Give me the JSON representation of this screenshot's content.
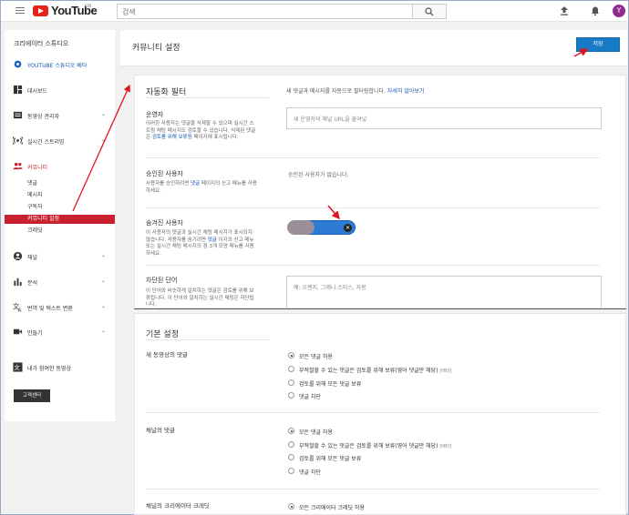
{
  "header": {
    "logo_text": "YouTube",
    "logo_region": "GB",
    "search_placeholder": "검색"
  },
  "sidebar": {
    "title": "크리에이터 스튜디오",
    "studio_beta": "YOUTUBE 스튜디오 베타",
    "dashboard": "대시보드",
    "video_manager": "동영상 관리자",
    "live": "실시간 스트리밍",
    "community": "커뮤니티",
    "community_items": [
      "댓글",
      "메시지",
      "구독자",
      "커뮤니티 설정",
      "크레딧"
    ],
    "channel": "채널",
    "analytics": "분석",
    "translation": "번역 및 텍스트 변환",
    "create": "만들기",
    "contributed": "내가 참여한 동영상",
    "help_button": "고객센터"
  },
  "main": {
    "title": "커뮤니티 설정",
    "save_label": "저장"
  },
  "auto_filter": {
    "title": "자동화 필터",
    "description": "새 댓글과 메시지를 자동으로 필터링합니다.",
    "learn_more": "자세히 알아보기",
    "moderators": {
      "title": "운영자",
      "desc_1": "이러한 사용자는 댓글을 삭제할 수 있으며 실시간 스트림 채팅 메시지도 검토할 수 있습니다. 삭제된 댓글은",
      "desc_link": "검토를 위해 보류됨",
      "desc_2": "페이지에 표시됩니다.",
      "placeholder": "새 운영자의 채널 URL을 붙여넣"
    },
    "approved": {
      "title": "승인된 사용자",
      "desc_1": "사용자를 승인하려면",
      "desc_link": "댓글",
      "desc_2": "페이지의 신고 메뉴를 사용하세요.",
      "value": "승인된 사용자가 없습니다."
    },
    "hidden": {
      "title": "숨겨진 사용자",
      "desc_1": "이 사용자의 댓글과 실시간 채팅 메시지가 표시되지 않습니다. 사용자를 숨기려면",
      "desc_link": "댓글",
      "desc_2": "이지의 신고 메뉴 또는 실시간 채팅 메시지의 점 3개 모양 메뉴를 사용하세요."
    },
    "blocked_words": {
      "title": "차단된 단어",
      "desc": "이 단어와 비슷하게 일치하는 댓글은 검토를 위해 보류됩니다. 이 단어와 일치하는 실시간 채팅은 자단됩니다.",
      "placeholder": "예: 오렌지, 그레니 스미스, 자몽"
    }
  },
  "defaults": {
    "title": "기본 설정",
    "new_video_comments": {
      "title": "새 동영상의 댓글",
      "options": [
        "모든 댓글 허용",
        "부적절할 수 있는 댓글은 검토를 위해 보류(영어 댓글만 해당)",
        "검토를 위해 모든 댓글 보류",
        "댓글 차단"
      ],
      "selected": 0
    },
    "channel_comments": {
      "title": "채널의 댓글",
      "options": [
        "모든 댓글 허용",
        "부적절할 수 있는 댓글은 검토를 위해 보류(영어 댓글만 해당)",
        "검토를 위해 모든 댓글 보류",
        "댓글 차단"
      ],
      "selected": 0
    },
    "creator_credits": {
      "title": "채널의 크리에이터 크레딧",
      "options": [
        "모든 크리에이터 크레딧 허용"
      ],
      "selected": 0
    },
    "beta_tag": "[베타]"
  },
  "colors": {
    "accent": "#167ac6",
    "active_nav": "#c8202e",
    "annotation": "#e0141e"
  }
}
